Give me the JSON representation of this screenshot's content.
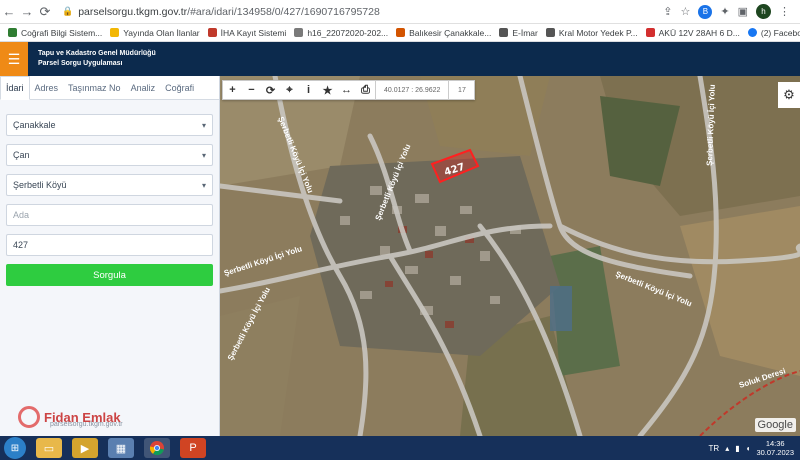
{
  "browser": {
    "url_domain": "parselsorgu.tkgm.gov.tr",
    "url_path": "/#ara/idari/134958/0/427/1690716795728",
    "profile_initial": "h"
  },
  "bookmarks": [
    {
      "label": "Coğrafi Bilgi Sistem...",
      "color": "#2f7d32"
    },
    {
      "label": "Yayında Olan İlanlar",
      "color": "#f2b705"
    },
    {
      "label": "İHA Kayıt Sistemi",
      "color": "#c0392b"
    },
    {
      "label": "h16_22072020-202...",
      "color": "#7a7a7a"
    },
    {
      "label": "Balıkesir Çanakkale...",
      "color": "#d35400"
    },
    {
      "label": "E-İmar",
      "color": "#555555"
    },
    {
      "label": "Kral Motor Yedek P...",
      "color": "#555555"
    },
    {
      "label": "AKÜ 12V 28AH 6 D...",
      "color": "#d32f2f"
    },
    {
      "label": "(2) Facebook",
      "color": "#1877f2"
    }
  ],
  "app": {
    "title_line1": "Tapu ve Kadastro Genel Müdürlüğü",
    "title_line2": "Parsel Sorgu Uygulaması"
  },
  "tabs": [
    "İdari",
    "Adres",
    "Taşınmaz No",
    "Analiz",
    "Coğrafi"
  ],
  "form": {
    "il": "Çanakkale",
    "ilce": "Çan",
    "mahalle": "Şerbetli Köyü",
    "ada_placeholder": "Ada",
    "parsel": "427",
    "submit": "Sorgula"
  },
  "footer_link": "parselsorgu.tkgm.gov.tr",
  "map": {
    "coords": "40.0127 : 26.9622",
    "zoom": "17",
    "parcel_label": "427",
    "road_labels": [
      "Şerbetli Köyü İçi Yolu",
      "Şerbetli Köyü İçi Yolu",
      "Şerbetli Köyü İçi Yolu",
      "Şerbetli Köyü İçi Yolu",
      "Şerbetli Köyü İçi Yolu",
      "Şerbetli Köyü İçi Yolu"
    ],
    "stream_label": "Soluk Deresi",
    "attribution": "Google"
  },
  "watermark": "Fidan Emlak",
  "taskbar": {
    "lang": "TR",
    "time": "14:36",
    "date": "30.07.2023"
  }
}
